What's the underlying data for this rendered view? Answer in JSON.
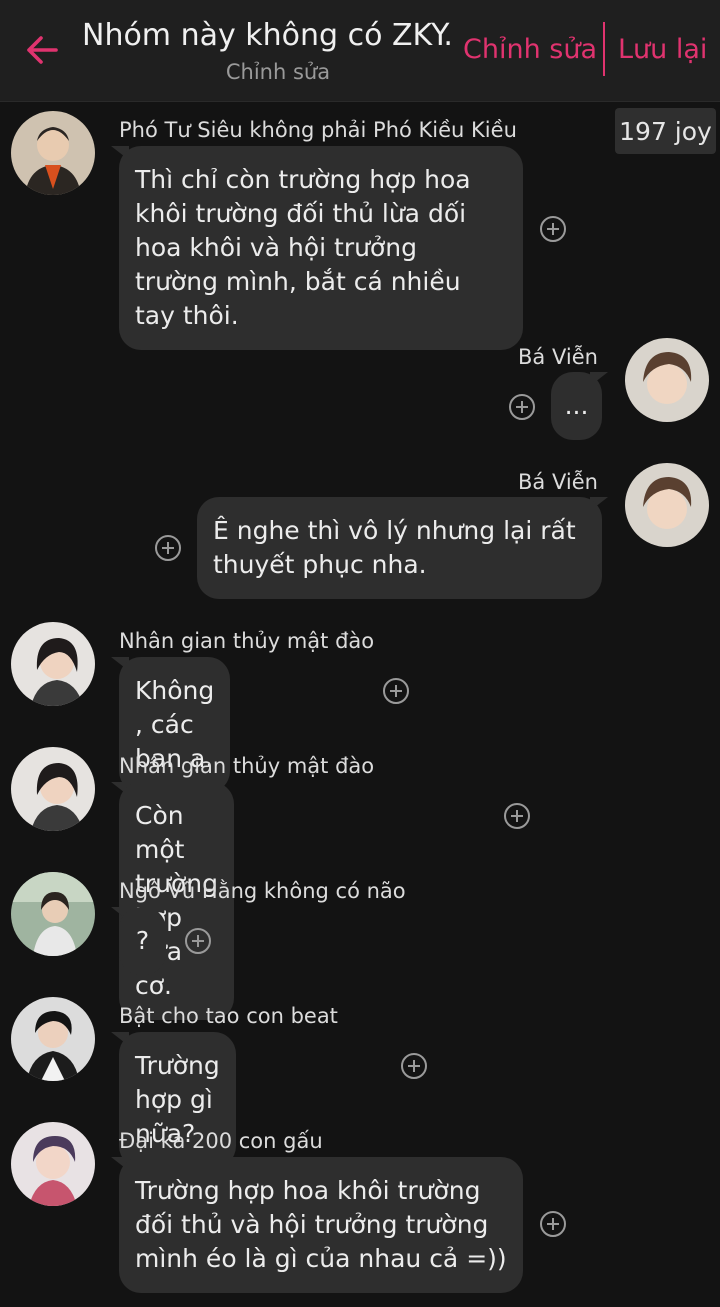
{
  "header": {
    "title": "Nhóm này không có ZKY...",
    "subtitle": "Chỉnh sửa",
    "edit_label": "Chỉnh sửa",
    "save_label": "Lưu lại",
    "accent_color": "#e0336f"
  },
  "joy_badge": "197 joy",
  "messages": [
    {
      "sender": "Phó Tư Siêu không phải Phó Kiều Kiều",
      "text": "Thì chỉ còn trường hợp hoa khôi trường đối thủ lừa dối hoa khôi và hội trưởng trường mình, bắt cá nhiều tay thôi.",
      "side": "left"
    },
    {
      "sender": "Bá Viễn",
      "text": "...",
      "side": "right"
    },
    {
      "sender": "Bá Viễn",
      "text": "Ê nghe thì vô lý nhưng lại rất thuyết phục nha.",
      "side": "right"
    },
    {
      "sender": "Nhân gian thủy mật đào",
      "text": "Không , các bạn ạ.",
      "side": "left"
    },
    {
      "sender": "Nhân gian thủy mật đào",
      "text": "Còn một trường hợp nữa cơ.",
      "side": "left"
    },
    {
      "sender": "Ngô Vũ Hằng không có não",
      "text": "?",
      "side": "left"
    },
    {
      "sender": "Bật cho tao con beat",
      "text": "Trường hợp gì nữa?",
      "side": "left"
    },
    {
      "sender": "Đại ka 200 con gấu",
      "text": "Trường hợp hoa khôi trường đối thủ và hội trưởng trường mình éo là gì của nhau cả =))",
      "side": "left"
    }
  ]
}
